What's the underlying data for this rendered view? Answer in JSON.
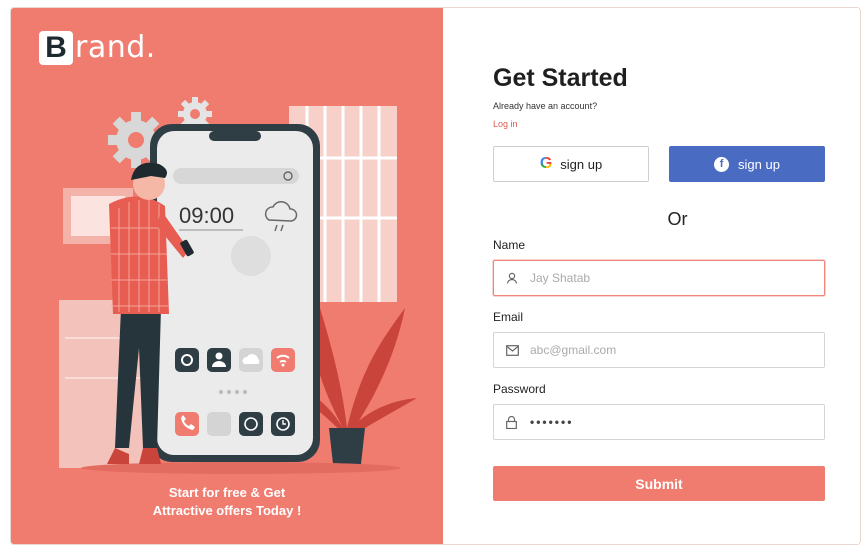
{
  "brand": {
    "initial": "B",
    "rest": "rand."
  },
  "illustration": {
    "phone_time": "09:00",
    "weather_icon": "cloud-icon",
    "app_icons": [
      "camera-icon",
      "user-icon",
      "cloud-icon",
      "wifi-icon",
      "phone-icon",
      "message-icon",
      "whatsapp-icon",
      "clock-icon"
    ]
  },
  "tagline": {
    "line1": "Start for free & Get",
    "line2": "Attractive offers Today !"
  },
  "form": {
    "title": "Get Started",
    "have_account": "Already have an account?",
    "login_link": "Log in",
    "google_button": {
      "icon": "google-icon",
      "glyph": "G",
      "label": "sign up"
    },
    "facebook_button": {
      "icon": "facebook-icon",
      "glyph": "f",
      "label": "sign up"
    },
    "or_text": "Or",
    "name": {
      "label": "Name",
      "placeholder": "Jay Shatab",
      "icon": "user-icon"
    },
    "email": {
      "label": "Email",
      "placeholder": "abc@gmail.com",
      "icon": "mail-icon"
    },
    "password": {
      "label": "Password",
      "value": "•••••••",
      "icon": "lock-icon"
    },
    "submit_label": "Submit"
  },
  "colors": {
    "accent": "#f07c70",
    "facebook": "#4a6bc2",
    "phone_dark": "#2f3d44",
    "link": "#e0584d"
  }
}
